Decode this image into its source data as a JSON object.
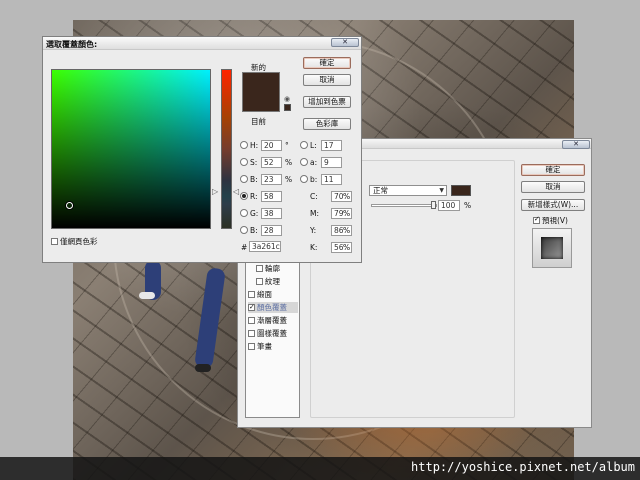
{
  "watermark": "http://yoshice.pixnet.net/album",
  "colors": {
    "new": "#3a261c",
    "old": "#3a261c",
    "dialog": "#ececec",
    "photo": "#756b60"
  },
  "picker": {
    "title": "選取覆蓋顏色:",
    "new_label": "新的",
    "current_label": "目前",
    "buttons": {
      "ok": "確定",
      "cancel": "取消",
      "add_swatch": "增加到色票",
      "libraries": "色彩庫"
    },
    "only_web_colors": "僅網頁色彩",
    "hsb": [
      {
        "key": "H:",
        "value": "20",
        "unit": "°",
        "selected": false
      },
      {
        "key": "S:",
        "value": "52",
        "unit": "%",
        "selected": false
      },
      {
        "key": "B:",
        "value": "23",
        "unit": "%",
        "selected": false
      }
    ],
    "rgb": [
      {
        "key": "R:",
        "value": "58",
        "selected": true
      },
      {
        "key": "G:",
        "value": "38",
        "selected": false
      },
      {
        "key": "B:",
        "value": "28",
        "selected": false
      }
    ],
    "lab": [
      {
        "key": "L:",
        "value": "17"
      },
      {
        "key": "a:",
        "value": "9"
      },
      {
        "key": "b:",
        "value": "11"
      }
    ],
    "cmyk": [
      {
        "key": "C:",
        "value": "70",
        "unit": "%"
      },
      {
        "key": "M:",
        "value": "79",
        "unit": "%"
      },
      {
        "key": "Y:",
        "value": "86",
        "unit": "%"
      },
      {
        "key": "K:",
        "value": "56",
        "unit": "%"
      }
    ],
    "hex_label": "#",
    "hex_value": "3a261c"
  },
  "layer_style": {
    "buttons": {
      "ok": "確定",
      "cancel": "取消",
      "new_style": "新增樣式(W)..."
    },
    "preview_label": "預視(V)",
    "blend_mode_value": "正常",
    "blend_mode_suffix": "):",
    "opacity_suffix": "):",
    "opacity_value": "100",
    "opacity_unit": "%",
    "styles": [
      {
        "label": "輪廓",
        "checked": false,
        "indent": true,
        "selected": false
      },
      {
        "label": "紋理",
        "checked": false,
        "indent": true,
        "selected": false
      },
      {
        "label": "緞面",
        "checked": false,
        "indent": false,
        "selected": false
      },
      {
        "label": "顏色覆蓋",
        "checked": true,
        "indent": false,
        "selected": true
      },
      {
        "label": "漸層覆蓋",
        "checked": false,
        "indent": false,
        "selected": false
      },
      {
        "label": "圖樣覆蓋",
        "checked": false,
        "indent": false,
        "selected": false
      },
      {
        "label": "筆畫",
        "checked": false,
        "indent": false,
        "selected": false
      }
    ]
  }
}
